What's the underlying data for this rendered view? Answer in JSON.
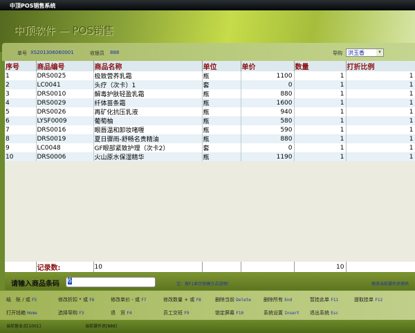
{
  "window_title": "中顶POS销售系统",
  "app_title": "中顶软件 — POS销售",
  "info": {
    "order_label": "单号",
    "order_no": "XS201306060001",
    "cashier_label": "收银员",
    "cashier": "888",
    "guide_label": "导购",
    "guide": "洪玉香"
  },
  "columns": [
    "序号",
    "商品编号",
    "商品名称",
    "单位",
    "单价",
    "数量",
    "打折比例"
  ],
  "rows": [
    [
      "1",
      "DRS0025",
      "极致营养乳霜",
      "瓶",
      "1100",
      "1",
      "1"
    ],
    [
      "2",
      "LC0041",
      "头疗（次卡）1",
      "套",
      "0",
      "1",
      "1"
    ],
    [
      "3",
      "DRS0010",
      "解毒护肤轻盈乳霜",
      "瓶",
      "880",
      "1",
      "1"
    ],
    [
      "4",
      "DRS0029",
      "纤体苗条霜",
      "瓶",
      "1600",
      "1",
      "1"
    ],
    [
      "5",
      "DRS0026",
      "再矿化抗压乳液",
      "瓶",
      "940",
      "1",
      "1"
    ],
    [
      "6",
      "LYSF0009",
      "葡萄柚",
      "瓶",
      "580",
      "1",
      "1"
    ],
    [
      "7",
      "DRS0016",
      "眼唇温和卸妆啫喱",
      "瓶",
      "590",
      "1",
      "1"
    ],
    [
      "8",
      "DRS0019",
      "夏日骤雨-舒畅名贵精油",
      "瓶",
      "880",
      "1",
      "1"
    ],
    [
      "9",
      "LC0048",
      "GF眼部紧致护理（次卡2）",
      "套",
      "0",
      "1",
      "1"
    ],
    [
      "10",
      "DRS0006",
      "火山原水保湿精华",
      "瓶",
      "1190",
      "1",
      "1"
    ]
  ],
  "footer": {
    "label": "记录数:",
    "count": "10",
    "qty_total": "10"
  },
  "input": {
    "label": "请输入商品条码",
    "value": "6",
    "hint": "注：按F1显示快捷方式说明!",
    "change_pwd": "修改当前操作员密码"
  },
  "shortcuts": [
    {
      "label": "结　账 / 或",
      "key": "F5"
    },
    {
      "label": "修改折扣 * 或",
      "key": "F6"
    },
    {
      "label": "修改单价 - 或",
      "key": "F7"
    },
    {
      "label": "修改数量 + 或",
      "key": "F8"
    },
    {
      "label": "删除当前",
      "key": "Delete"
    },
    {
      "label": "删除所有",
      "key": "End"
    },
    {
      "label": "暂挂此单",
      "key": "F11"
    },
    {
      "label": "提取挂单",
      "key": "F12"
    },
    {
      "label": "打开钱箱",
      "key": "Home"
    },
    {
      "label": "选择导购",
      "key": "F3"
    },
    {
      "label": "退　货",
      "key": "F4"
    },
    {
      "label": "员工交班",
      "key": "F9"
    },
    {
      "label": "锁定屏幕",
      "key": "F10"
    },
    {
      "label": "系统设置",
      "key": "Insert"
    },
    {
      "label": "退出系统",
      "key": "Esc"
    }
  ],
  "status": {
    "store": "当前营业点[1001]",
    "operator": "当前操作员[888]"
  }
}
